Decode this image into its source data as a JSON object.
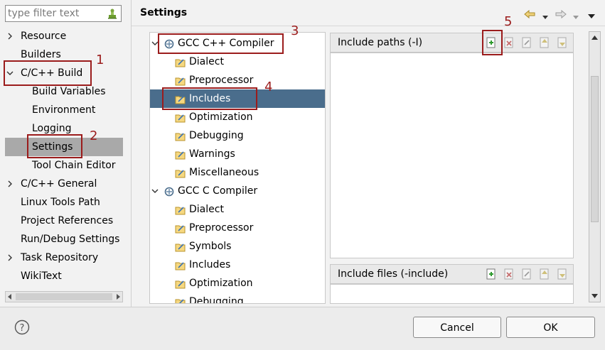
{
  "filter": {
    "placeholder": "type filter text"
  },
  "nav": {
    "resource": "Resource",
    "builders": "Builders",
    "cpp_build": "C/C++ Build",
    "build_variables": "Build Variables",
    "environment": "Environment",
    "logging": "Logging",
    "settings": "Settings",
    "tool_chain_editor": "Tool Chain Editor",
    "cpp_general": "C/C++ General",
    "linux_tools_path": "Linux Tools Path",
    "project_references": "Project References",
    "run_debug_settings": "Run/Debug Settings",
    "task_repository": "Task Repository",
    "wikitext": "WikiText"
  },
  "page": {
    "title": "Settings"
  },
  "tree": {
    "gcc_cpp": "GCC C++ Compiler",
    "cpp_dialect": "Dialect",
    "cpp_preprocessor": "Preprocessor",
    "cpp_includes": "Includes",
    "cpp_optimization": "Optimization",
    "cpp_debugging": "Debugging",
    "cpp_warnings": "Warnings",
    "cpp_miscellaneous": "Miscellaneous",
    "gcc_c": "GCC C Compiler",
    "c_dialect": "Dialect",
    "c_preprocessor": "Preprocessor",
    "c_symbols": "Symbols",
    "c_includes": "Includes",
    "c_optimization": "Optimization",
    "c_debugging": "Debugging"
  },
  "panels": {
    "include_paths": "Include paths (-I)",
    "include_files": "Include files (-include)"
  },
  "buttons": {
    "cancel": "Cancel",
    "ok": "OK"
  },
  "annotations": [
    "1",
    "2",
    "3",
    "4",
    "5"
  ],
  "colors": {
    "selection": "#4a6d8c",
    "annotation": "#9b1c1c",
    "nav_selected": "#a9a9a9"
  }
}
